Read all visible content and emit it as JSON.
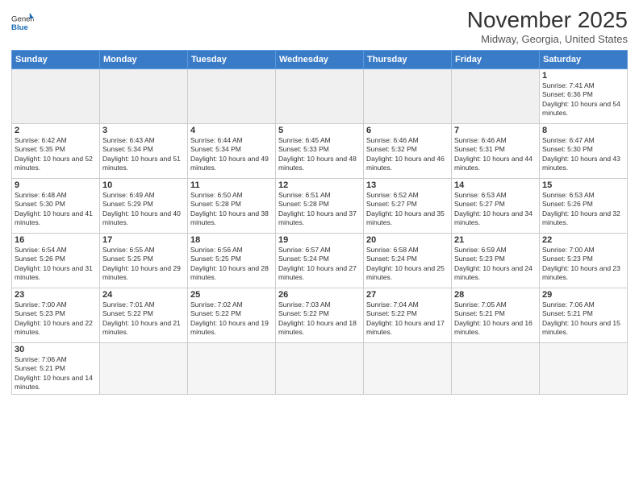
{
  "header": {
    "logo_general": "General",
    "logo_blue": "Blue",
    "month_title": "November 2025",
    "subtitle": "Midway, Georgia, United States"
  },
  "days_of_week": [
    "Sunday",
    "Monday",
    "Tuesday",
    "Wednesday",
    "Thursday",
    "Friday",
    "Saturday"
  ],
  "weeks": [
    [
      {
        "day": "",
        "empty": true
      },
      {
        "day": "",
        "empty": true
      },
      {
        "day": "",
        "empty": true
      },
      {
        "day": "",
        "empty": true
      },
      {
        "day": "",
        "empty": true
      },
      {
        "day": "",
        "empty": true
      },
      {
        "day": "1",
        "sunrise": "Sunrise: 7:41 AM",
        "sunset": "Sunset: 6:36 PM",
        "daylight": "Daylight: 10 hours and 54 minutes."
      }
    ],
    [
      {
        "day": "2",
        "sunrise": "Sunrise: 6:42 AM",
        "sunset": "Sunset: 5:35 PM",
        "daylight": "Daylight: 10 hours and 52 minutes."
      },
      {
        "day": "3",
        "sunrise": "Sunrise: 6:43 AM",
        "sunset": "Sunset: 5:34 PM",
        "daylight": "Daylight: 10 hours and 51 minutes."
      },
      {
        "day": "4",
        "sunrise": "Sunrise: 6:44 AM",
        "sunset": "Sunset: 5:34 PM",
        "daylight": "Daylight: 10 hours and 49 minutes."
      },
      {
        "day": "5",
        "sunrise": "Sunrise: 6:45 AM",
        "sunset": "Sunset: 5:33 PM",
        "daylight": "Daylight: 10 hours and 48 minutes."
      },
      {
        "day": "6",
        "sunrise": "Sunrise: 6:46 AM",
        "sunset": "Sunset: 5:32 PM",
        "daylight": "Daylight: 10 hours and 46 minutes."
      },
      {
        "day": "7",
        "sunrise": "Sunrise: 6:46 AM",
        "sunset": "Sunset: 5:31 PM",
        "daylight": "Daylight: 10 hours and 44 minutes."
      },
      {
        "day": "8",
        "sunrise": "Sunrise: 6:47 AM",
        "sunset": "Sunset: 5:30 PM",
        "daylight": "Daylight: 10 hours and 43 minutes."
      }
    ],
    [
      {
        "day": "9",
        "sunrise": "Sunrise: 6:48 AM",
        "sunset": "Sunset: 5:30 PM",
        "daylight": "Daylight: 10 hours and 41 minutes."
      },
      {
        "day": "10",
        "sunrise": "Sunrise: 6:49 AM",
        "sunset": "Sunset: 5:29 PM",
        "daylight": "Daylight: 10 hours and 40 minutes."
      },
      {
        "day": "11",
        "sunrise": "Sunrise: 6:50 AM",
        "sunset": "Sunset: 5:28 PM",
        "daylight": "Daylight: 10 hours and 38 minutes."
      },
      {
        "day": "12",
        "sunrise": "Sunrise: 6:51 AM",
        "sunset": "Sunset: 5:28 PM",
        "daylight": "Daylight: 10 hours and 37 minutes."
      },
      {
        "day": "13",
        "sunrise": "Sunrise: 6:52 AM",
        "sunset": "Sunset: 5:27 PM",
        "daylight": "Daylight: 10 hours and 35 minutes."
      },
      {
        "day": "14",
        "sunrise": "Sunrise: 6:53 AM",
        "sunset": "Sunset: 5:27 PM",
        "daylight": "Daylight: 10 hours and 34 minutes."
      },
      {
        "day": "15",
        "sunrise": "Sunrise: 6:53 AM",
        "sunset": "Sunset: 5:26 PM",
        "daylight": "Daylight: 10 hours and 32 minutes."
      }
    ],
    [
      {
        "day": "16",
        "sunrise": "Sunrise: 6:54 AM",
        "sunset": "Sunset: 5:26 PM",
        "daylight": "Daylight: 10 hours and 31 minutes."
      },
      {
        "day": "17",
        "sunrise": "Sunrise: 6:55 AM",
        "sunset": "Sunset: 5:25 PM",
        "daylight": "Daylight: 10 hours and 29 minutes."
      },
      {
        "day": "18",
        "sunrise": "Sunrise: 6:56 AM",
        "sunset": "Sunset: 5:25 PM",
        "daylight": "Daylight: 10 hours and 28 minutes."
      },
      {
        "day": "19",
        "sunrise": "Sunrise: 6:57 AM",
        "sunset": "Sunset: 5:24 PM",
        "daylight": "Daylight: 10 hours and 27 minutes."
      },
      {
        "day": "20",
        "sunrise": "Sunrise: 6:58 AM",
        "sunset": "Sunset: 5:24 PM",
        "daylight": "Daylight: 10 hours and 25 minutes."
      },
      {
        "day": "21",
        "sunrise": "Sunrise: 6:59 AM",
        "sunset": "Sunset: 5:23 PM",
        "daylight": "Daylight: 10 hours and 24 minutes."
      },
      {
        "day": "22",
        "sunrise": "Sunrise: 7:00 AM",
        "sunset": "Sunset: 5:23 PM",
        "daylight": "Daylight: 10 hours and 23 minutes."
      }
    ],
    [
      {
        "day": "23",
        "sunrise": "Sunrise: 7:00 AM",
        "sunset": "Sunset: 5:23 PM",
        "daylight": "Daylight: 10 hours and 22 minutes."
      },
      {
        "day": "24",
        "sunrise": "Sunrise: 7:01 AM",
        "sunset": "Sunset: 5:22 PM",
        "daylight": "Daylight: 10 hours and 21 minutes."
      },
      {
        "day": "25",
        "sunrise": "Sunrise: 7:02 AM",
        "sunset": "Sunset: 5:22 PM",
        "daylight": "Daylight: 10 hours and 19 minutes."
      },
      {
        "day": "26",
        "sunrise": "Sunrise: 7:03 AM",
        "sunset": "Sunset: 5:22 PM",
        "daylight": "Daylight: 10 hours and 18 minutes."
      },
      {
        "day": "27",
        "sunrise": "Sunrise: 7:04 AM",
        "sunset": "Sunset: 5:22 PM",
        "daylight": "Daylight: 10 hours and 17 minutes."
      },
      {
        "day": "28",
        "sunrise": "Sunrise: 7:05 AM",
        "sunset": "Sunset: 5:21 PM",
        "daylight": "Daylight: 10 hours and 16 minutes."
      },
      {
        "day": "29",
        "sunrise": "Sunrise: 7:06 AM",
        "sunset": "Sunset: 5:21 PM",
        "daylight": "Daylight: 10 hours and 15 minutes."
      }
    ],
    [
      {
        "day": "30",
        "sunrise": "Sunrise: 7:06 AM",
        "sunset": "Sunset: 5:21 PM",
        "daylight": "Daylight: 10 hours and 14 minutes.",
        "last": true
      },
      {
        "day": "",
        "empty": true,
        "last": true
      },
      {
        "day": "",
        "empty": true,
        "last": true
      },
      {
        "day": "",
        "empty": true,
        "last": true
      },
      {
        "day": "",
        "empty": true,
        "last": true
      },
      {
        "day": "",
        "empty": true,
        "last": true
      },
      {
        "day": "",
        "empty": true,
        "last": true
      }
    ]
  ]
}
